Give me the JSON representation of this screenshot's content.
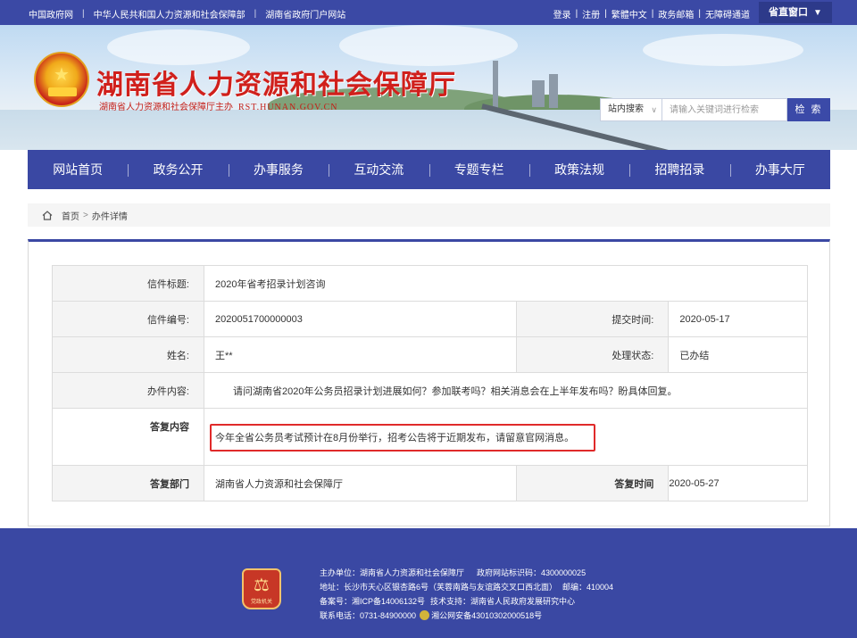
{
  "topbar": {
    "links": [
      "中国政府网",
      "中华人民共和国人力资源和社会保障部",
      "湖南省政府门户网站"
    ],
    "right_links": [
      "登录",
      "注册",
      "繁體中文",
      "政务邮箱",
      "无障碍通道"
    ],
    "province_window": "省直窗口",
    "province_arrow": "▼"
  },
  "header": {
    "title": "湖南省人力资源和社会保障厅",
    "subtitle": "湖南省人力资源和社会保障厅主办",
    "domain": "RST.HUNAN.GOV.CN"
  },
  "search": {
    "scope": "站内搜索",
    "placeholder": "请输入关键词进行检索",
    "button": "检 索"
  },
  "nav": [
    "网站首页",
    "政务公开",
    "办事服务",
    "互动交流",
    "专题专栏",
    "政策法规",
    "招聘招录",
    "办事大厅"
  ],
  "breadcrumb": {
    "home": "首页",
    "separator": ">",
    "current": "办件详情"
  },
  "letter": {
    "title_label": "信件标题:",
    "title": "2020年省考招录计划咨询",
    "number_label": "信件编号:",
    "number": "2020051700000003",
    "submit_time_label": "提交时间:",
    "submit_time": "2020-05-17",
    "name_label": "姓名:",
    "name": "王**",
    "status_label": "处理状态:",
    "status": "已办结",
    "content_label": "办件内容:",
    "content": "请问湖南省2020年公务员招录计划进展如何？参加联考吗？相关消息会在上半年发布吗？盼具体回复。",
    "reply_label": "答复内容",
    "reply": "今年全省公务员考试预计在8月份举行，招考公告将于近期发布，请留意官网消息。",
    "reply_dept_label": "答复部门",
    "reply_dept": "湖南省人力资源和社会保障厅",
    "reply_time_label": "答复时间",
    "reply_time": "2020-05-27"
  },
  "footer": {
    "logo_text": "党政机关",
    "logo_glyph": "⚖",
    "sponsor": "主办单位：湖南省人力资源和社会保障厅",
    "site_code": "政府网站标识码：4300000025",
    "address": "地址：长沙市天心区银杏路6号（芙蓉南路与友谊路交叉口西北面）",
    "postcode": "邮编：410004",
    "icp": "备案号：湘ICP备14006132号",
    "tech": "技术支持：湖南省人民政府发展研究中心",
    "phone": "联系电话：0731-84900000",
    "police": "湘公网安备43010302000518号"
  },
  "colors": {
    "primary": "#3a48a3",
    "title_red": "#d0201c",
    "highlight_border": "#e02a2a"
  }
}
